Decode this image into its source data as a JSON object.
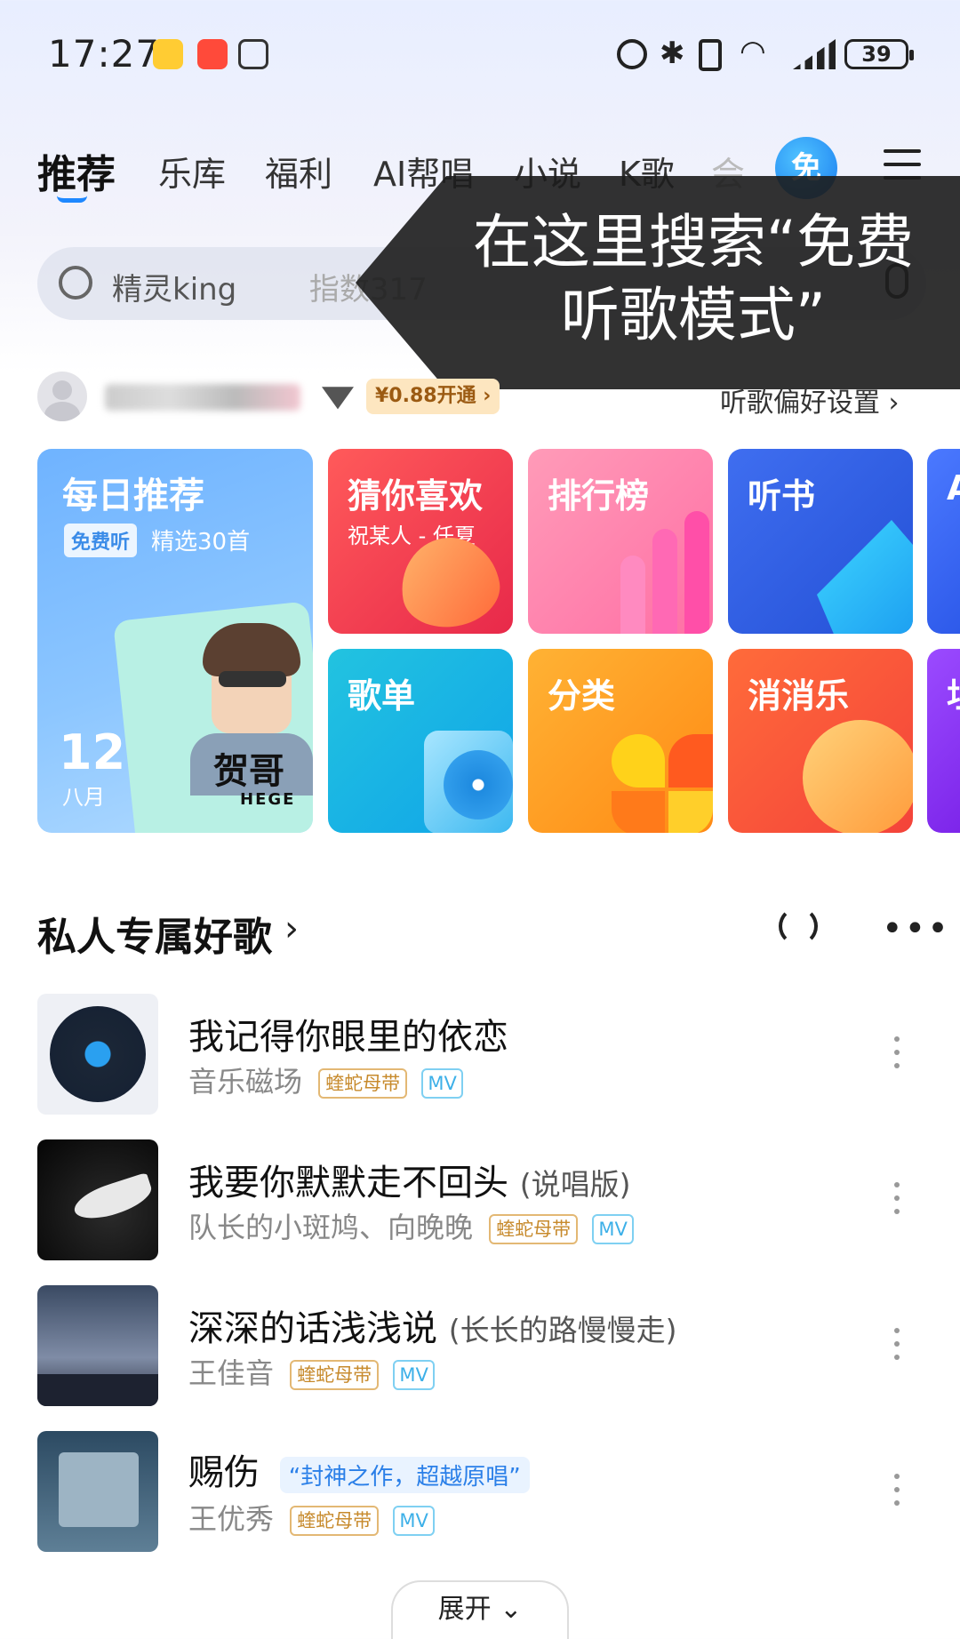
{
  "status_bar": {
    "time": "17:27",
    "battery": "39"
  },
  "tabs": [
    {
      "label": "推荐"
    },
    {
      "label": "乐库"
    },
    {
      "label": "福利"
    },
    {
      "label": "AI帮唱"
    },
    {
      "label": "小说"
    },
    {
      "label": "K歌"
    },
    {
      "label": "会"
    }
  ],
  "free_button": "免",
  "search": {
    "text": "精灵king",
    "hot_index": "指数317"
  },
  "callout": {
    "text": "在这里搜索“免费听歌模式”"
  },
  "user": {
    "vip_offer": "¥0.88开通 ›",
    "pref_link": "听歌偏好设置 ›"
  },
  "tiles": {
    "daily": {
      "title": "每日推荐",
      "badge": "免费听",
      "subtitle": "精选30首",
      "day": "12",
      "month": "八月",
      "art_text": "贺哥",
      "art_text_en": "HEGE"
    },
    "guess": {
      "title": "猜你喜欢",
      "subtitle": "祝某人 - 任夏"
    },
    "rank": {
      "title": "排行榜"
    },
    "book": {
      "title": "听书"
    },
    "playlist": {
      "title": "歌单"
    },
    "category": {
      "title": "分类"
    },
    "game": {
      "title": "消消乐"
    },
    "edge1": {
      "title": "A"
    },
    "edge2": {
      "title": "坦"
    }
  },
  "section": {
    "title": "私人专属好歌",
    "arrow": "›"
  },
  "songs": [
    {
      "title": "我记得你眼里的依恋",
      "version": "",
      "artist": "音乐磁场",
      "tag": "蝰蛇母带",
      "mv": "MV",
      "quote": ""
    },
    {
      "title": "我要你默默走不回头",
      "version": "(说唱版)",
      "artist": "队长的小斑鸠、向晚晚",
      "tag": "蝰蛇母带",
      "mv": "MV",
      "quote": ""
    },
    {
      "title": "深深的话浅浅说",
      "version": "(长长的路慢慢走)",
      "artist": "王佳音",
      "tag": "蝰蛇母带",
      "mv": "MV",
      "quote": ""
    },
    {
      "title": "赐伤",
      "version": "",
      "artist": "王优秀",
      "tag": "蝰蛇母带",
      "mv": "MV",
      "quote": "“封神之作，超越原唱”"
    }
  ],
  "expand": {
    "label": "展开 ⌄"
  }
}
